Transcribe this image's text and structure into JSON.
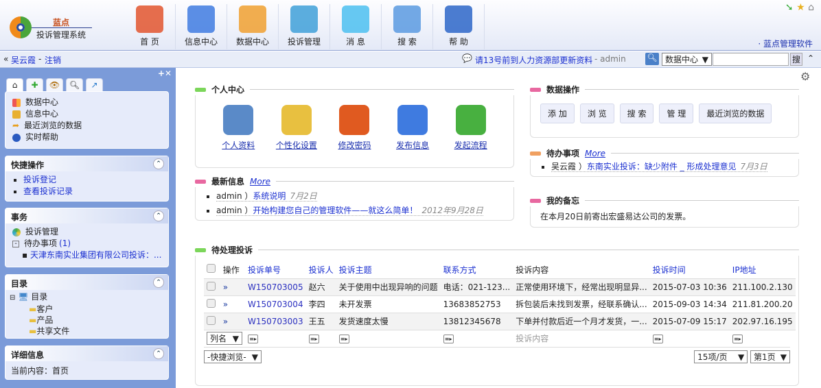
{
  "header": {
    "logo_top": "蓝点",
    "logo_bottom": "投诉管理系统",
    "brand_link": "· 蓝点管理软件",
    "nav": [
      {
        "label": "首 页",
        "icon": "home-icon",
        "color": "#e2552e"
      },
      {
        "label": "信息中心",
        "icon": "finder-icon",
        "color": "#3f7be0"
      },
      {
        "label": "数据中心",
        "icon": "grid-icon",
        "color": "#f0a030"
      },
      {
        "label": "投诉管理",
        "icon": "ring-icon",
        "color": "#3fa0d8"
      },
      {
        "label": "消 息",
        "icon": "chat-bubbles-icon",
        "color": "#4cc0f0"
      },
      {
        "label": "搜 索",
        "icon": "folder-search-icon",
        "color": "#5a9ae0"
      },
      {
        "label": "帮 助",
        "icon": "help-icon",
        "color": "#2d66c8"
      }
    ]
  },
  "bar": {
    "user": "吴云霞",
    "sep": "-",
    "logout": "注销",
    "notice": "请13号前到人力资源部更新资料",
    "notice_by": "- admin",
    "search_scope": "数据中心",
    "search_value": "",
    "search_button": "搜"
  },
  "sidebar": {
    "menu": [
      "数据中心",
      "信息中心",
      "最近浏览的数据",
      "实时帮助"
    ],
    "quick": {
      "title": "快捷操作",
      "items": [
        "投诉登记",
        "查看投诉记录"
      ]
    },
    "affairs": {
      "title": "事务",
      "item": "投诉管理",
      "todo": "待办事项",
      "todo_count": "(1)",
      "todo_item": "天津东南实业集团有限公司投诉：..."
    },
    "catalog": {
      "title": "目录",
      "root": "目录",
      "children": [
        "客户",
        "产品",
        "共享文件"
      ]
    },
    "detail": {
      "title": "详细信息",
      "text": "当前内容：首页"
    }
  },
  "main": {
    "personal": {
      "title": "个人中心",
      "items": [
        {
          "label": "个人资料",
          "color": "#5a8ac8"
        },
        {
          "label": "个性化设置",
          "color": "#e8c040"
        },
        {
          "label": "修改密码",
          "color": "#e05a20"
        },
        {
          "label": "发布信息",
          "color": "#3f7be0"
        },
        {
          "label": "发起流程",
          "color": "#48b040"
        }
      ]
    },
    "news": {
      "title": "最新信息",
      "more": "More",
      "items": [
        {
          "author": "admin ）",
          "title": "系统说明",
          "date": "7月2日"
        },
        {
          "author": "admin ）",
          "title": "开始构建您自己的管理软件——就这么简单！",
          "date": "2012年9月28日"
        }
      ]
    },
    "data_ops": {
      "title": "数据操作",
      "buttons": [
        "添 加",
        "浏 览",
        "搜 索",
        "管 理",
        "最近浏览的数据"
      ]
    },
    "todo": {
      "title": "待办事项",
      "more": "More",
      "items": [
        {
          "author": "吴云霞 ）",
          "title": "东南实业投诉：缺少附件 _ 形成处理意见",
          "date": "7月3日"
        }
      ]
    },
    "memo": {
      "title": "我的备忘",
      "text": "在本月20日前寄出宏盛易达公司的发票。"
    },
    "complaints": {
      "title": "待处理投诉",
      "columns": [
        "操作",
        "投诉单号",
        "投诉人",
        "投诉主题",
        "联系方式",
        "投诉内容",
        "投诉时间",
        "IP地址"
      ],
      "rows": [
        [
          "»",
          "W150703005",
          "赵六",
          "关于使用中出现异响的问题",
          "电话：021-123...",
          "正常使用环境下，经常出现明显异...",
          "2015-07-03 10:36",
          "211.100.2.130"
        ],
        [
          "»",
          "W150703004",
          "李四",
          "未开发票",
          "13683852753",
          "拆包装后未找到发票，经联系确认...",
          "2015-09-03 14:34",
          "211.81.200.20"
        ],
        [
          "»",
          "W150703003",
          "王五",
          "发货速度太慢",
          "13812345678",
          "下单并付款后近一个月才发货，一...",
          "2015-07-09 15:17",
          "202.97.16.195"
        ]
      ],
      "filter_select": "列名",
      "filter_placeholder": "投诉内容",
      "quick_browse": "-快捷浏览-",
      "page_size": "15项/页",
      "page": "第1页"
    }
  }
}
